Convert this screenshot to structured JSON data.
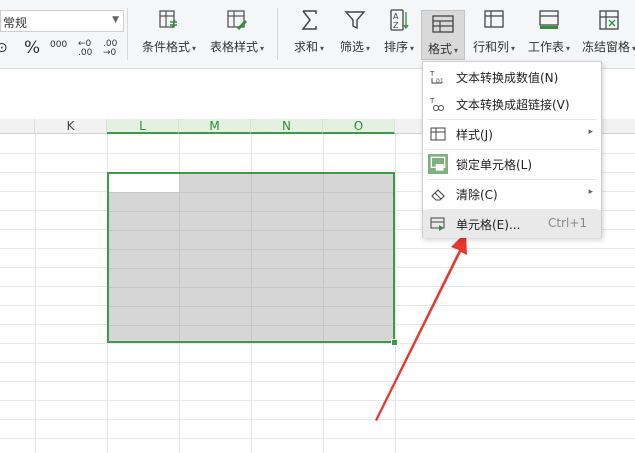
{
  "ribbon": {
    "number_format": "常规",
    "percent_symbol": "%",
    "thousands_symbol": "000",
    "increase_decimal": "⁺⁰ .00",
    "decrease_decimal": ".00 →0",
    "buttons": [
      {
        "label": "条件格式",
        "icon": "conditional-format-icon"
      },
      {
        "label": "表格样式",
        "icon": "table-style-icon"
      },
      {
        "label": "求和",
        "icon": "sum-icon"
      },
      {
        "label": "筛选",
        "icon": "filter-icon"
      },
      {
        "label": "排序",
        "icon": "sort-icon"
      },
      {
        "label": "格式",
        "icon": "format-icon"
      },
      {
        "label": "行和列",
        "icon": "row-col-icon"
      },
      {
        "label": "工作表",
        "icon": "worksheet-icon"
      },
      {
        "label": "冻结窗格",
        "icon": "freeze-pane-icon"
      }
    ]
  },
  "columns": [
    {
      "label": "K",
      "selected": false
    },
    {
      "label": "L",
      "selected": true
    },
    {
      "label": "M",
      "selected": true
    },
    {
      "label": "N",
      "selected": true
    },
    {
      "label": "O",
      "selected": true
    }
  ],
  "menu": {
    "items": [
      {
        "label": "文本转换成数值(N)",
        "icon": "text-to-number-icon"
      },
      {
        "label": "文本转换成超链接(V)",
        "icon": "text-to-hyperlink-icon"
      },
      {
        "label": "样式(J)",
        "icon": "style-icon",
        "submenu": true
      },
      {
        "label": "锁定单元格(L)",
        "icon": "lock-cell-icon"
      },
      {
        "label": "清除(C)",
        "icon": "eraser-icon",
        "submenu": true
      },
      {
        "label": "单元格(E)...",
        "icon": "cell-format-icon",
        "shortcut": "Ctrl+1"
      }
    ]
  },
  "colors": {
    "selection_border": "#3d9b47",
    "arrow": "#e8382f",
    "selection_fill": "#d6d6d6"
  }
}
